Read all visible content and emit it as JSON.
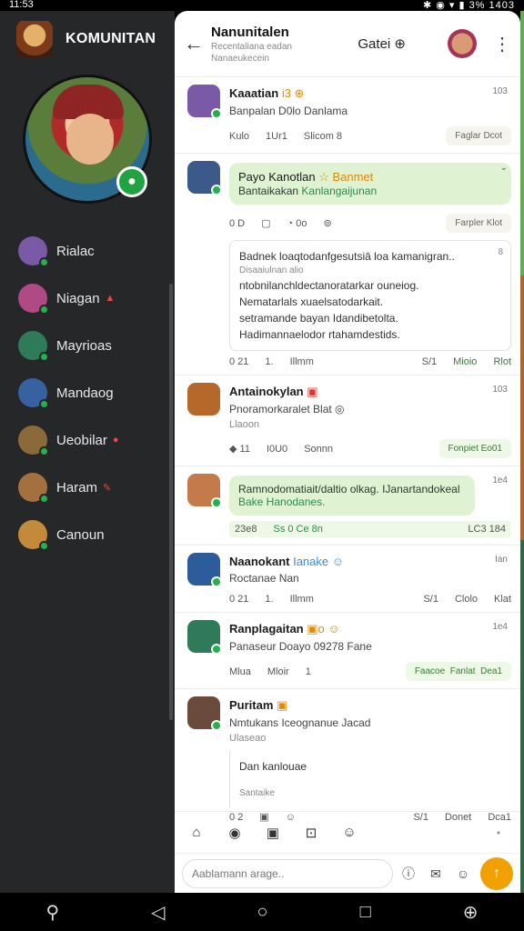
{
  "status": {
    "time": "11:53",
    "right": "✱ ◉ ▾ ▮ 3% 1403"
  },
  "drawer": {
    "brand": "KOMUNITAN",
    "items": [
      {
        "label": "Rialac",
        "color": "#7a5aa6",
        "badge": ""
      },
      {
        "label": "Niagan",
        "color": "#b04a85",
        "badge": "▲"
      },
      {
        "label": "Mayrioas",
        "color": "#2f7a58",
        "badge": ""
      },
      {
        "label": "Mandaog",
        "color": "#3761a0",
        "badge": ""
      },
      {
        "label": "Ueobilar",
        "color": "#8b6a3a",
        "badge": "●"
      },
      {
        "label": "Haram",
        "color": "#a57040",
        "badge": "✎"
      },
      {
        "label": "Canoun",
        "color": "#c38a3c",
        "badge": ""
      }
    ]
  },
  "header": {
    "title": "Nanunitalen",
    "sub1": "Recentaliana eadan",
    "sub2": "Nanaeukecein",
    "gate": "Gatei",
    "gate_icon": "⊕"
  },
  "messages": [
    {
      "name": "Kaaatian",
      "tag": "i3 ⊕",
      "time": "103",
      "text": "Banpalan D0lo Danlama",
      "meta": [
        "Kulo",
        "1Ur1",
        "Slicom 8"
      ],
      "chips": [
        "Faglar",
        "Dcot"
      ]
    },
    {
      "name": "Payo Kanotlan",
      "tag": "☆ Banmet",
      "time": "",
      "bubble": "Bantaikakan",
      "bubble_kw": "Kanlangaijunan",
      "meta": [
        "0 D",
        "▢",
        "◔ 0o",
        "⊚"
      ],
      "chips": [
        "Farpler",
        "Klot"
      ],
      "quote": [
        "Badnek loaqtodanfgesutsiā loa kamanigran..",
        "Disaaiulnan alio",
        "ntobnilanchldectanoratarkar ouneiog.",
        "Nematarlals xuaelsatodarkait.",
        "setramande bayan Idandibetolta.",
        "Hadimannaelodor rtahamdestids."
      ],
      "quote_x": "8",
      "meta2": [
        "0 21",
        "1.",
        "Illmm",
        "S/1",
        "Mioio",
        "Rlot"
      ]
    },
    {
      "name": "Antainokylan",
      "tag": "▣",
      "time": "103",
      "text": "Pnoramorkaralet Blat ◎",
      "sub": "Llaoon",
      "meta": [
        "◆ 11",
        "I0U0",
        "Sonnn"
      ],
      "chips": [
        "Fonpiet",
        "Eo01"
      ]
    },
    {
      "name": "",
      "tag": "",
      "time": "1e4",
      "bubble": "Ramnodomatiait/daltio olkag. IJanartandokeal",
      "bubble_kw": "Bake Hanodanes.",
      "meta": [
        "23e8",
        "Ss 0 Ce 8n",
        "LC3 184"
      ]
    },
    {
      "name": "Naanokant",
      "tag": "Ianake ☺",
      "time": "Ian",
      "text": "Roctanae Nan",
      "meta": [
        "0 21",
        "1.",
        "Illmm",
        "S/1",
        "Clolo",
        "Klat"
      ]
    },
    {
      "name": "Ranplagaitan",
      "tag": "▣o ☺",
      "time": "1e4",
      "text": "Panaseur Doayo 09278 Fane",
      "meta": [
        "Mlua",
        "Mloir",
        "1"
      ],
      "chips": [
        "Faacoe",
        "Fanlat",
        "Dea1"
      ]
    },
    {
      "name": "Puritam",
      "tag": "▣",
      "time": "",
      "text": "Nmtukans Iceognanue Jacad",
      "sub": "Ulaseao",
      "quote_text": "Dan kanlouae",
      "quote_sub": "Santaike",
      "meta": [
        "0 2",
        "▣",
        "☺",
        "S/1",
        "Donet",
        "Dca1"
      ]
    }
  ],
  "composer": {
    "placeholder": "Aablamann arage.."
  },
  "navbar": [
    "⚲",
    "◁",
    "○",
    "□",
    "⊕"
  ]
}
